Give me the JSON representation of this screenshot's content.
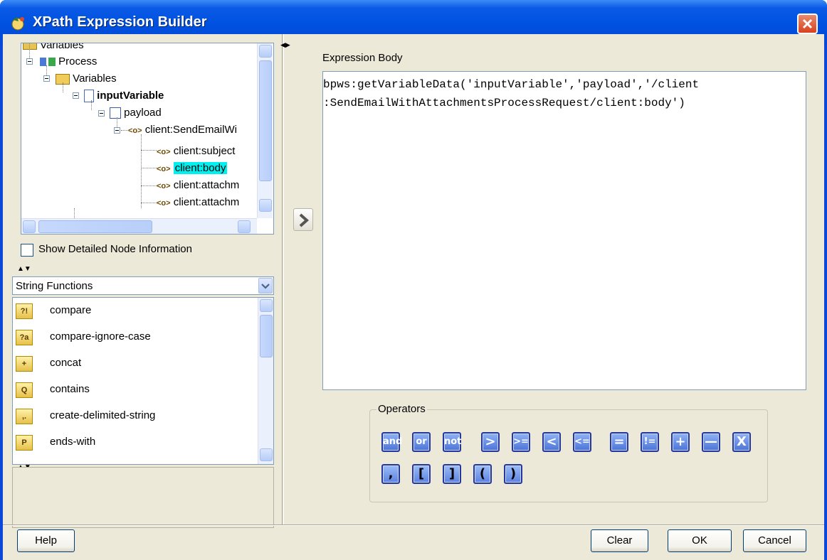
{
  "window": {
    "title": "XPath Expression Builder"
  },
  "tree": {
    "nodes": [
      {
        "label": "Variables"
      },
      {
        "label": "Process"
      },
      {
        "label": "Variables"
      },
      {
        "label": "inputVariable"
      },
      {
        "label": "payload"
      },
      {
        "label": "client:SendEmailWi"
      },
      {
        "label": "client:subject"
      },
      {
        "label": "client:body"
      },
      {
        "label": "client:attachm"
      },
      {
        "label": "client:attachm"
      }
    ]
  },
  "show_detailed": {
    "label": "Show Detailed Node Information",
    "checked": false
  },
  "functions": {
    "category": "String Functions",
    "items": [
      {
        "label": "compare",
        "icon": "?!"
      },
      {
        "label": "compare-ignore-case",
        "icon": "?a"
      },
      {
        "label": "concat",
        "icon": "+"
      },
      {
        "label": "contains",
        "icon": "Q"
      },
      {
        "label": "create-delimited-string",
        "icon": ",."
      },
      {
        "label": "ends-with",
        "icon": "P"
      }
    ]
  },
  "expression": {
    "label": "Expression Body",
    "lines": [
      "bpws:getVariableData('inputVariable','payload','/client",
      ":SendEmailWithAttachmentsProcessRequest/client:body')"
    ]
  },
  "operators": {
    "label": "Operators",
    "row1": [
      "and",
      "or",
      "not",
      ">",
      ">=",
      "<",
      "<=",
      "=",
      "!=",
      "+",
      "—",
      "X"
    ],
    "row2": [
      ",",
      "[",
      "]",
      "(",
      ")"
    ]
  },
  "buttons": {
    "help": "Help",
    "clear": "Clear",
    "ok": "OK",
    "cancel": "Cancel"
  },
  "colors": {
    "titlebar": "#0050e0",
    "selection": "#00f0f0",
    "face": "#ece9d8"
  }
}
